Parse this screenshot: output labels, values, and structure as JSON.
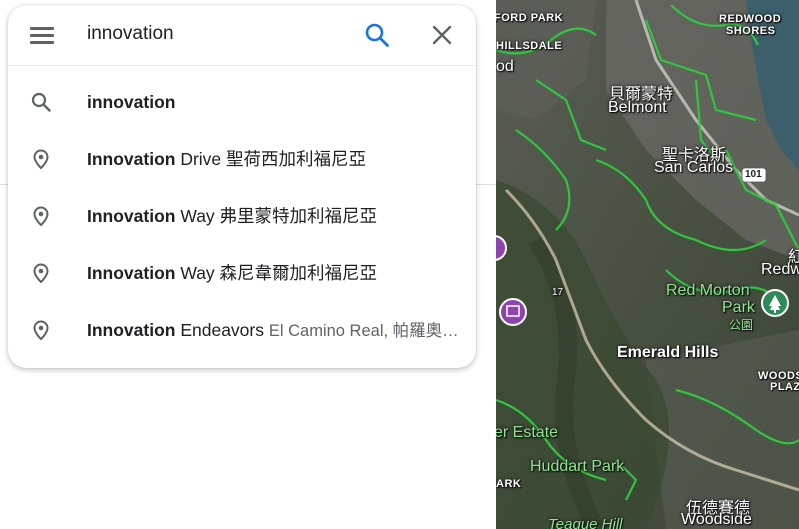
{
  "search": {
    "query": "innovation",
    "menu_icon": "hamburger-menu-icon",
    "search_icon": "magnifier-icon",
    "clear_icon": "close-icon"
  },
  "suggestions": [
    {
      "icon": "magnifier-icon",
      "bold": "innovation",
      "rest": "",
      "secondary": ""
    },
    {
      "icon": "location-pin-icon",
      "bold": "Innovation",
      "rest": " Drive 聖荷西加利福尼亞",
      "secondary": ""
    },
    {
      "icon": "location-pin-icon",
      "bold": "Innovation",
      "rest": " Way 弗里蒙特加利福尼亞",
      "secondary": ""
    },
    {
      "icon": "location-pin-icon",
      "bold": "Innovation",
      "rest": " Way 森尼韋爾加利福尼亞",
      "secondary": ""
    },
    {
      "icon": "location-pin-icon",
      "bold": "Innovation",
      "rest": " Endeavors ",
      "secondary": "El Camino Real, 帕羅奧…"
    }
  ],
  "map": {
    "labels": {
      "ford_park": "FORD PARK",
      "hillsdale": "HILLSDALE",
      "od": "od",
      "redwood_shores_1": "REDWOOD",
      "redwood_shores_2": "SHORES",
      "belmont_zh": "貝爾蒙特",
      "belmont_en": "Belmont",
      "san_carlos_zh": "聖卡洛斯",
      "san_carlos_en": "San Carlos",
      "highway_101": "101",
      "redw_zh": "紅",
      "redw_en": "Redw",
      "red_morton_1": "Red Morton",
      "red_morton_2": "Park",
      "red_morton_3": "公園",
      "highway_17": "17",
      "emerald_hills": "Emerald Hills",
      "woods_1": "WOODS",
      "woods_2": "PLAZ",
      "estate": "er Estate",
      "huddart_park": "Huddart Park",
      "ark": "ARK",
      "woodside_zh": "伍德賽德",
      "woodside_en": "Woodside",
      "teague_hill": "Teague Hill"
    },
    "colors": {
      "route_green": "#2ecc40",
      "park_label": "#8ee68e",
      "water": "#3c5f6b",
      "pin_purple": "#8e44ad"
    }
  }
}
